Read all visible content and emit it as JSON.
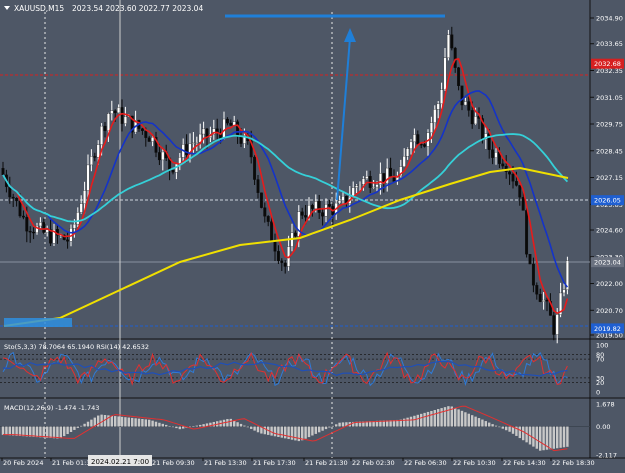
{
  "header": {
    "symbol": "XAUUSD,M15",
    "ohlc": "2023.54 2023.60 2022.77 2023.04"
  },
  "price_axis": {
    "labels": [
      "2034.90",
      "2033.65",
      "2032.35",
      "2031.05",
      "2029.75",
      "2028.45",
      "2027.15",
      "2025.85",
      "2024.60",
      "2023.30",
      "2022.00",
      "2020.70",
      "2019.50"
    ],
    "tags": [
      {
        "text": "2032.68",
        "color": "#d62020",
        "value": 2032.68
      },
      {
        "text": "2026.05",
        "color": "#1f5fd1",
        "value": 2026.05
      },
      {
        "text": "2023.04",
        "color": "#6b7280",
        "value": 2023.04
      },
      {
        "text": "2019.82",
        "color": "#1f5fd1",
        "value": 2019.82
      }
    ]
  },
  "stoch_panel": {
    "label": "Sto(5,3,3) 78.7064 65.1940  RSI(14) 42.6532",
    "axis_labels": [
      "100",
      "80",
      "70",
      "30",
      "20",
      "0"
    ]
  },
  "macd_panel": {
    "label": "MACD(12,26,9) -1.474 -1.743",
    "axis_labels": [
      "1.678",
      "0.00",
      "-2.117"
    ]
  },
  "time_axis": {
    "labels": [
      "20 Feb 2024",
      "21 Feb 01:3",
      "21 Feb 09:30",
      "21 Feb 13:30",
      "21 Feb 17:30",
      "21 Feb 21:30",
      "22 Feb 02:30",
      "22 Feb 06:30",
      "22 Feb 10:30",
      "22 Feb 14:30",
      "22 Feb 18:30"
    ],
    "crosshair_label": "2024.02.21 7:00"
  },
  "colors": {
    "background": "#4e5766",
    "bull_candle": "#ffffff",
    "bear_candle": "#0a0a0a",
    "ma_red": "#e51c1c",
    "ma_blue": "#1433c8",
    "ma_cyan": "#35d0d8",
    "ma_yellow": "#f0e000",
    "stoch_main": "#2f7bd8",
    "stoch_signal": "#e23030",
    "macd_hist": "#c8c8c8",
    "macd_signal": "#e23030"
  }
}
